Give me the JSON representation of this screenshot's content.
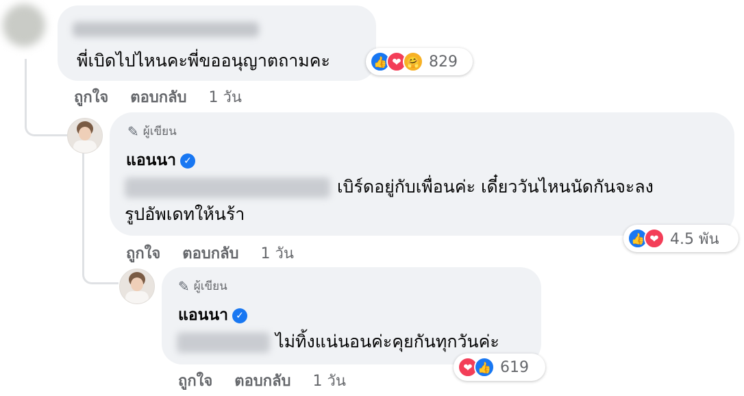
{
  "comments": [
    {
      "text": "พี่เบิดไปไหนคะพี่ขออนุญาตถามคะ",
      "reactions": [
        "like",
        "love",
        "care"
      ],
      "reaction_count": "829",
      "actions": {
        "like": "ถูกใจ",
        "reply": "ตอบกลับ",
        "time": "1 วัน"
      }
    },
    {
      "badge": "ผู้เขียน",
      "author": "แอนนา",
      "text": "เบิร์ดอยู่กับเพื่อนค่ะ เดี๋ยววันไหนนัดกันจะลง",
      "text2": "รูปอัพเดทให้นร้า",
      "reactions": [
        "like",
        "love"
      ],
      "reaction_count": "4.5 พัน",
      "actions": {
        "like": "ถูกใจ",
        "reply": "ตอบกลับ",
        "time": "1 วัน"
      }
    },
    {
      "badge": "ผู้เขียน",
      "author": "แอนนา",
      "text": "ไม่ทิ้งแน่นอนค่ะคุยกันทุกวันค่ะ",
      "reactions": [
        "love",
        "like"
      ],
      "reaction_count": "619",
      "actions": {
        "like": "ถูกใจ",
        "reply": "ตอบกลับ",
        "time": "1 วัน"
      }
    }
  ],
  "colors": {
    "like": "#1877f2",
    "love": "#f33e58",
    "care": "#f7b125",
    "bubble": "#f0f2f5",
    "meta": "#65676b"
  }
}
